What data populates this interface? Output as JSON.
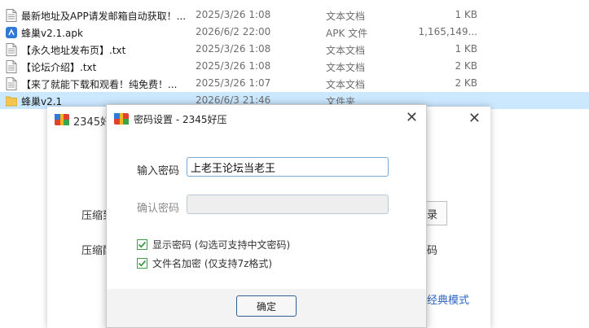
{
  "files": [
    {
      "name": "最新地址及APP请发邮箱自动获取！...",
      "date": "2025/3/26 1:08",
      "type": "文本文档",
      "size": "1 KB",
      "icon": "text-file-icon"
    },
    {
      "name": "蜂巢v2.1.apk",
      "date": "2026/6/2 22:00",
      "type": "APK 文件",
      "size": "1,165,149...",
      "icon": "apk-file-icon"
    },
    {
      "name": "【永久地址发布页】.txt",
      "date": "2025/3/26 1:08",
      "type": "文本文档",
      "size": "1 KB",
      "icon": "text-file-icon"
    },
    {
      "name": "【论坛介绍】.txt",
      "date": "2025/3/26 1:08",
      "type": "文本文档",
      "size": "2 KB",
      "icon": "text-file-icon"
    },
    {
      "name": "【来了就能下载和观看！纯免费！...",
      "date": "2025/3/26 1:07",
      "type": "文本文档",
      "size": "2 KB",
      "icon": "text-file-icon"
    },
    {
      "name": "蜂巢v2.1",
      "date": "2026/6/3 21:46",
      "type": "文件夹",
      "size": "",
      "icon": "folder-icon",
      "selected": true
    }
  ],
  "bg_window": {
    "title": "2345好",
    "label_compress": "压缩到",
    "label_compress2": "压缩配",
    "right_button": "录",
    "right_label": "码",
    "classic_link": "经典模式"
  },
  "dialog": {
    "title": "密码设置 - 2345好压",
    "password_label": "输入密码",
    "password_value": "上老王论坛当老王",
    "confirm_label": "确认密码",
    "confirm_value": "",
    "show_password_label": "显示密码 (勾选可支持中文密码)",
    "show_password_checked": true,
    "encrypt_names_label": "文件名加密 (仅支持7z格式)",
    "encrypt_names_checked": true,
    "ok_label": "确定"
  },
  "colors": {
    "selected_row": "#cce8ff",
    "check_green": "#3d9b4a",
    "link_blue": "#2b64c5",
    "logo_red": "#e0412f",
    "logo_blue": "#2f7ad6",
    "logo_green": "#3aa44b",
    "logo_yellow": "#f1b521"
  }
}
